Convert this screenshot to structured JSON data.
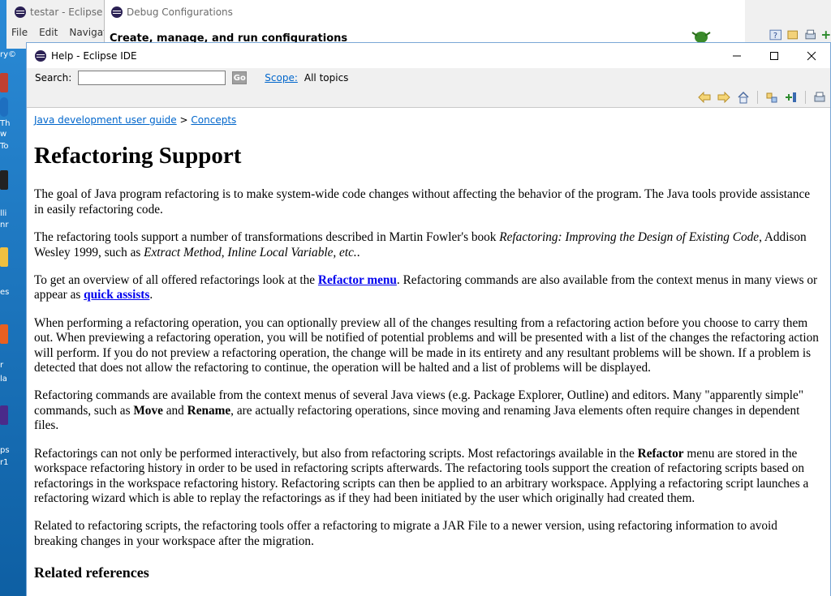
{
  "eclipse": {
    "title": "testar - Eclipse I",
    "menu": [
      "File",
      "Edit",
      "Navigat"
    ],
    "debug_title": "Debug Configurations",
    "debug_heading": "Create, manage, and run configurations"
  },
  "help": {
    "title": "Help - Eclipse IDE",
    "search_label": "Search:",
    "search_value": "",
    "go_label": "Go",
    "scope_label": "Scope:",
    "scope_value": "All topics",
    "breadcrumb": {
      "parent": "Java development user guide",
      "sep": ">",
      "current": "Concepts"
    },
    "heading": "Refactoring Support",
    "p1": "The goal of Java program refactoring is to make system-wide code changes without affecting the behavior of the program. The Java tools provide assistance in easily refactoring code.",
    "p2_a": "The refactoring tools support a number of transformations described in Martin Fowler's book ",
    "p2_book": "Refactoring: Improving the Design of Existing Code",
    "p2_b": ", Addison Wesley 1999, such as ",
    "p2_ex1": "Extract Method",
    "p2_c": ", ",
    "p2_ex2": "Inline Local Variable, etc.",
    "p2_d": ".",
    "p3_a": "To get an overview of all offered refactorings look at the ",
    "p3_link1": "Refactor menu",
    "p3_b": ". Refactoring commands are also available from the context menus in many views or appear as ",
    "p3_link2": "quick assists",
    "p3_c": ".",
    "p4": "When performing a refactoring operation, you can optionally preview all of the changes resulting from a refactoring action before you choose to carry them out. When previewing a refactoring operation, you will be notified of potential problems and will be presented with a list of the changes the refactoring action will perform. If you do not preview a refactoring operation, the change will be made in its entirety and any resultant problems will be shown. If a problem is detected that does not allow the refactoring to continue, the operation will be halted and a list of problems will be displayed.",
    "p5_a": "Refactoring commands are available from the context menus of several Java views (e.g. Package Explorer, Outline) and editors. Many \"apparently simple\" commands, such as ",
    "p5_move": "Move",
    "p5_b": " and ",
    "p5_rename": "Rename",
    "p5_c": ", are actually refactoring operations, since moving and renaming Java elements often require changes in dependent files.",
    "p6_a": "Refactorings can not only be performed interactively, but also from refactoring scripts. Most refactorings available in the ",
    "p6_refactor": "Refactor",
    "p6_b": " menu are stored in the workspace refactoring history in order to be used in refactoring scripts afterwards. The refactoring tools support the creation of refactoring scripts based on refactorings in the workspace refactoring history. Refactoring scripts can then be applied to an arbitrary workspace. Applying a refactoring script launches a refactoring wizard which is able to replay the refactorings as if they had been initiated by the user which originally had created them.",
    "p7": "Related to refactoring scripts, the refactoring tools offer a refactoring to migrate a JAR File to a newer version, using refactoring information to avoid breaking changes in your workspace after the migration.",
    "related": "Related references"
  },
  "desktop": {
    "fragments": [
      "ry©",
      "Th",
      "w",
      "To",
      "lli",
      "nr",
      "es",
      "r",
      "la",
      "ps",
      "r1"
    ]
  },
  "icons": {
    "back": "back-arrow-icon",
    "forward": "forward-arrow-icon",
    "home": "home-icon",
    "sync": "sync-toc-icon",
    "bookmark": "bookmark-icon",
    "print": "print-icon"
  }
}
